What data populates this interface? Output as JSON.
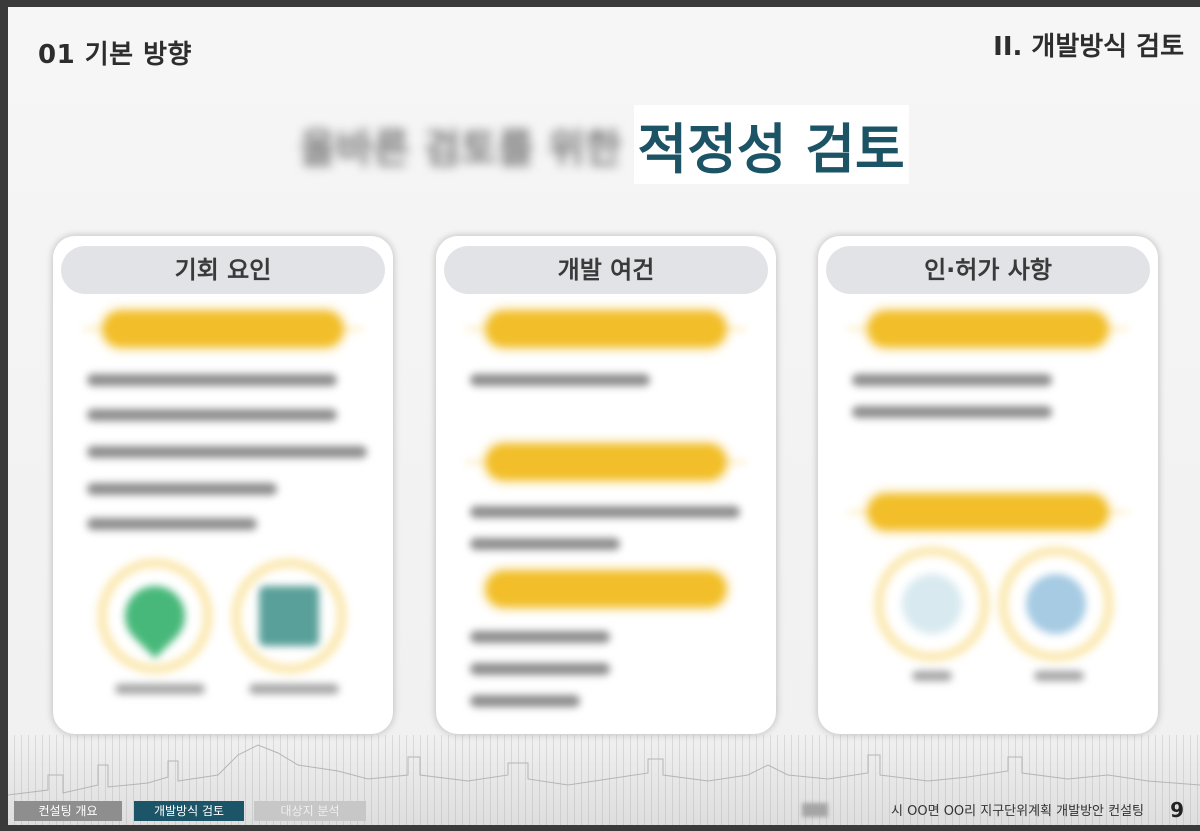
{
  "header": {
    "section": "01 기본 방향",
    "chapter": "II. 개발방식 검토"
  },
  "headline": {
    "blurred_prefix": "올바른 검토를 위한",
    "main": "적정성 검토"
  },
  "cards": [
    {
      "title": "기회 요인"
    },
    {
      "title": "개발 여건"
    },
    {
      "title": "인·허가 사항"
    }
  ],
  "footer": {
    "tabs": [
      "컨설팅 개요",
      "개발방식 검토",
      "대상지 분석"
    ],
    "doc_title": "시 OO면 OO리 지구단위계획 개발방안 컨설팅",
    "page": "9"
  },
  "colors": {
    "accent": "#1c5466",
    "pill": "#f2bf2a",
    "card_header": "#e2e3e7"
  }
}
